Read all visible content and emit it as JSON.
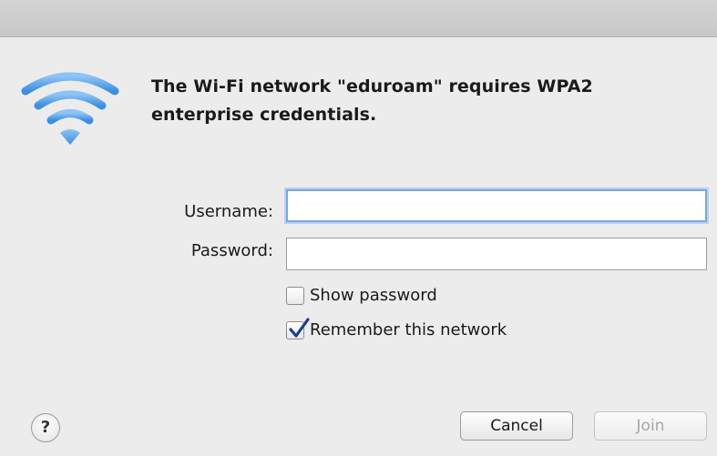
{
  "dialog": {
    "message": "The Wi-Fi network \"eduroam\" requires WPA2 enterprise credentials.",
    "icon": "wifi-icon",
    "accent_color": "#4a90e2"
  },
  "form": {
    "username_label": "Username:",
    "username_value": "",
    "password_label": "Password:",
    "password_value": ""
  },
  "options": {
    "show_password_label": "Show password",
    "show_password_checked": false,
    "remember_label": "Remember this network",
    "remember_checked": true
  },
  "buttons": {
    "help_label": "?",
    "cancel_label": "Cancel",
    "join_label": "Join",
    "join_enabled": false
  }
}
